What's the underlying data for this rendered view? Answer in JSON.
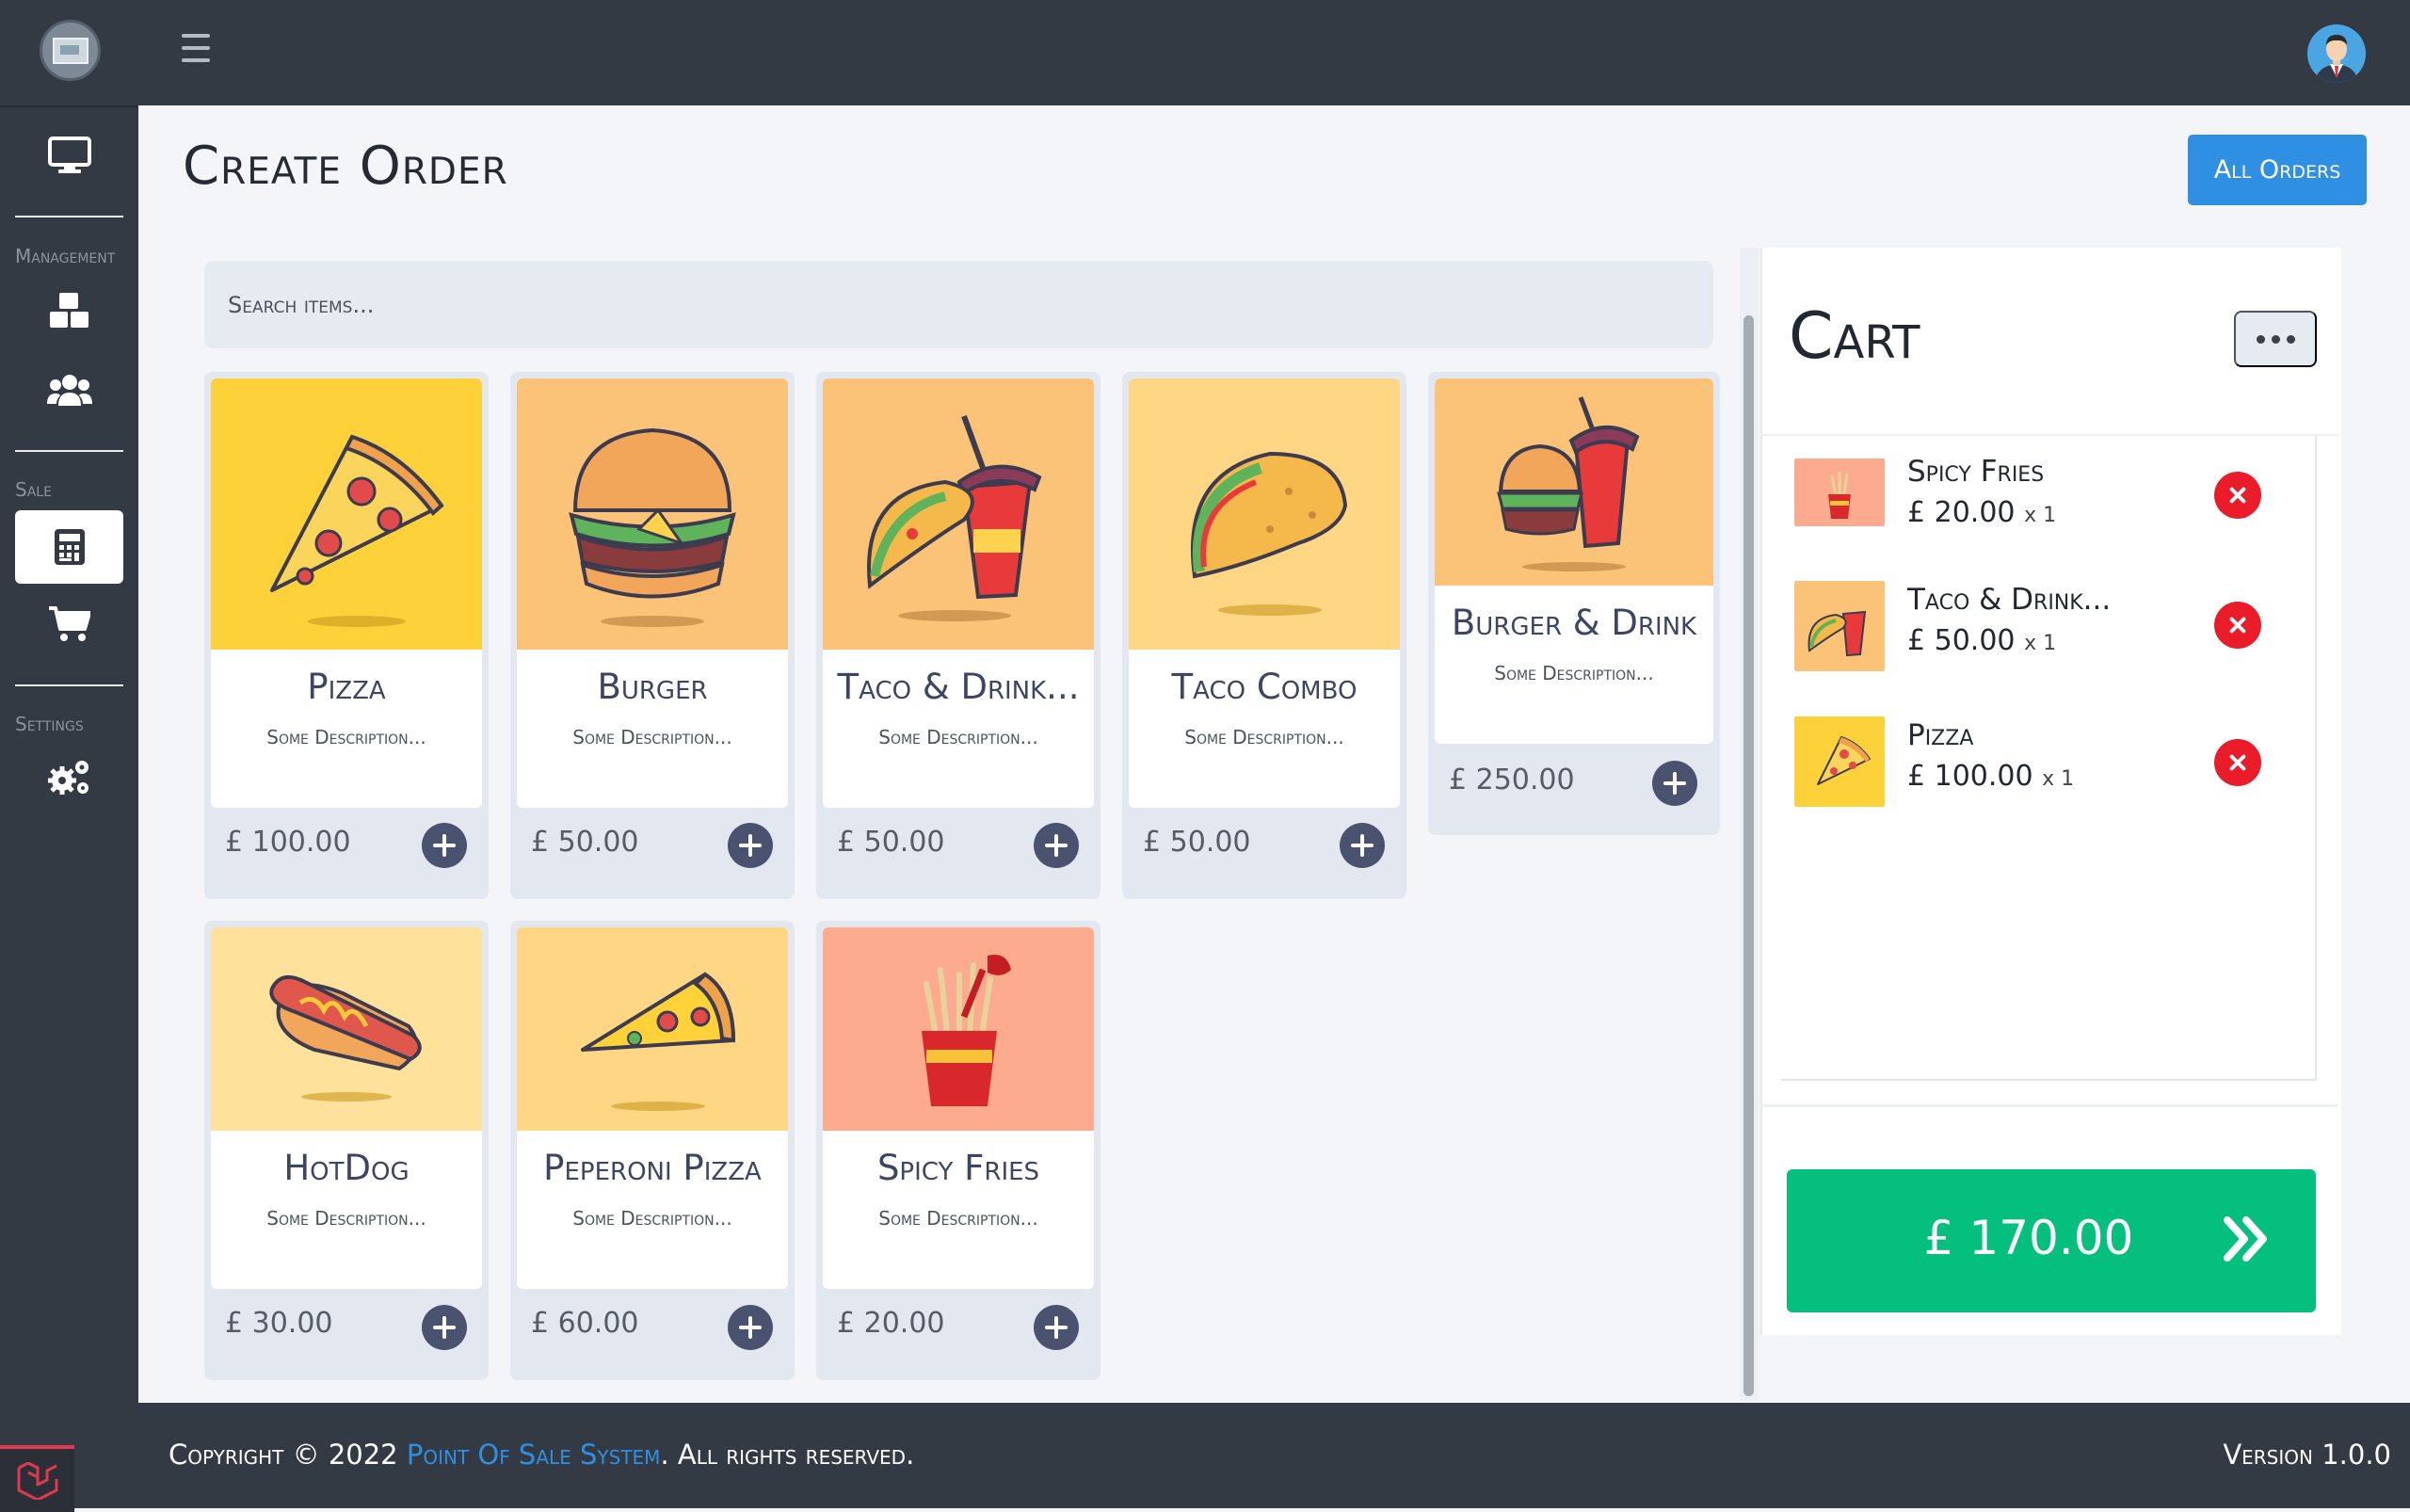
{
  "sidebar": {
    "sections": [
      "Management",
      "Sale",
      "Settings"
    ]
  },
  "header": {
    "title": "Create Order",
    "all_orders_label": "All Orders"
  },
  "search": {
    "placeholder": "Search items..."
  },
  "products": [
    {
      "name": "Pizza",
      "description": "Some Description...",
      "price": "£ 100.00",
      "image": "pizza-slice",
      "bg": "#fdd13a"
    },
    {
      "name": "Burger",
      "description": "Some Description...",
      "price": "£ 50.00",
      "image": "burger",
      "bg": "#fbc377"
    },
    {
      "name": "Taco & Drink...",
      "description": "Some Description...",
      "price": "£ 50.00",
      "image": "taco-and-drink",
      "bg": "#fbc377"
    },
    {
      "name": "Taco Combo",
      "description": "Some Description...",
      "price": "£ 50.00",
      "image": "taco",
      "bg": "#fed684"
    },
    {
      "name": "Burger & Drink",
      "description": "Some Description...",
      "price": "£ 250.00",
      "image": "burger-and-drink",
      "bg": "#fbc377"
    },
    {
      "name": "HotDog",
      "description": "Some Description...",
      "price": "£ 30.00",
      "image": "hotdog",
      "bg": "#fee29b"
    },
    {
      "name": "Peperoni Pizza",
      "description": "Some Description...",
      "price": "£ 60.00",
      "image": "pepperoni-pizza",
      "bg": "#fed684"
    },
    {
      "name": "Spicy Fries",
      "description": "Some Description...",
      "price": "£ 20.00",
      "image": "fries",
      "bg": "#fcab8e"
    }
  ],
  "cart": {
    "title": "Cart",
    "items": [
      {
        "name": "Spicy Fries",
        "price": "£ 20.00",
        "qty": "x 1"
      },
      {
        "name": "Taco & Drink...",
        "price": "£ 50.00",
        "qty": "x 1"
      },
      {
        "name": "Pizza",
        "price": "£ 100.00",
        "qty": "x 1"
      }
    ],
    "total": "£ 170.00"
  },
  "footer": {
    "copyright_prefix": "Copyright © 2022",
    "system_name": "Point Of Sale System",
    "rights": ". All rights reserved.",
    "version": "Version 1.0.0"
  }
}
